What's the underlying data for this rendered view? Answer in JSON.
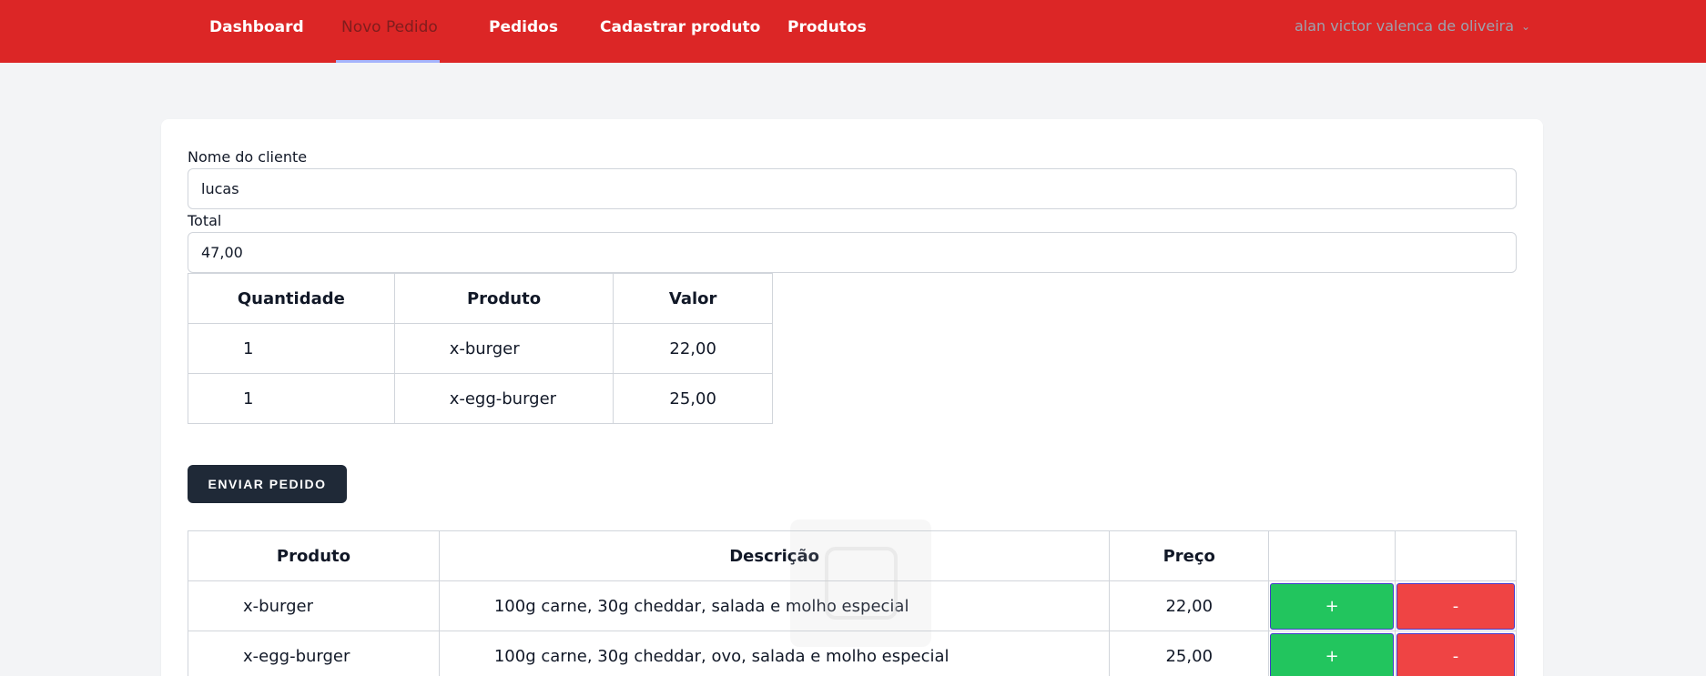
{
  "nav": {
    "items": [
      {
        "label": "Dashboard"
      },
      {
        "label": "Novo Pedido"
      },
      {
        "label": "Pedidos"
      },
      {
        "label": "Cadastrar produto"
      },
      {
        "label": "Produtos"
      }
    ],
    "active": "Novo Pedido",
    "user_name": "alan victor valenca de oliveira",
    "user_menu_icon": "chevron-down-icon"
  },
  "form": {
    "client_label": "Nome do cliente",
    "client_value": "lucas",
    "total_label": "Total",
    "total_value": "47,00"
  },
  "cart": {
    "headers": [
      "Quantidade",
      "Produto",
      "Valor"
    ],
    "rows": [
      {
        "qty": "1",
        "product": "x-burger",
        "value": "22,00"
      },
      {
        "qty": "1",
        "product": "x-egg-burger",
        "value": "25,00"
      }
    ]
  },
  "send_button": "ENVIAR PEDIDO",
  "products": {
    "headers": [
      "Produto",
      "Descrição",
      "Preço",
      "",
      ""
    ],
    "rows": [
      {
        "name": "x-burger",
        "description": "100g carne, 30g cheddar, salada e molho especial",
        "price": "22,00",
        "add": "+",
        "remove": "-"
      },
      {
        "name": "x-egg-burger",
        "description": "100g carne, 30g cheddar, ovo, salada e molho especial",
        "price": "25,00",
        "add": "+",
        "remove": "-"
      }
    ]
  },
  "colors": {
    "topbar": "#dc2626",
    "add_button": "#22c55e",
    "remove_button": "#ef4444",
    "send_button": "#1f2937"
  }
}
